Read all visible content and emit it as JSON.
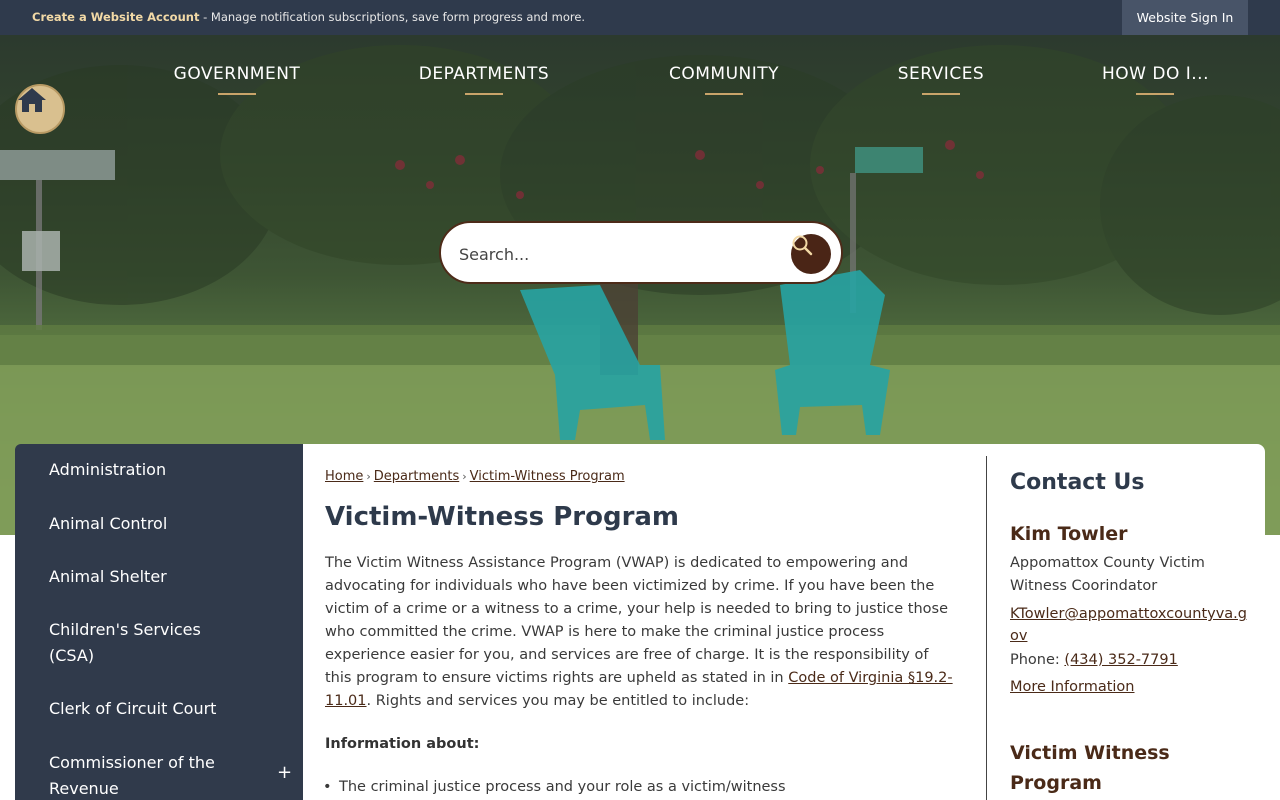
{
  "topbar": {
    "create_account_link": "Create a Website Account",
    "create_account_rest": " - Manage notification subscriptions, save form progress and more.",
    "sign_in": "Website Sign In"
  },
  "nav": {
    "items": [
      "GOVERNMENT",
      "DEPARTMENTS",
      "COMMUNITY",
      "SERVICES",
      "HOW DO I..."
    ]
  },
  "search": {
    "placeholder": "Search..."
  },
  "sidebar": {
    "items": [
      "Administration",
      "Animal Control",
      "Animal Shelter",
      "Children's Services (CSA)",
      "Clerk of Circuit Court",
      "Commissioner of the Revenue"
    ],
    "expand_symbol": "+"
  },
  "breadcrumb": {
    "items": [
      "Home",
      "Departments",
      "Victim-Witness Program"
    ],
    "separator": "›"
  },
  "main": {
    "title": "Victim-Witness Program",
    "intro": "The Victim Witness Assistance Program (VWAP) is dedicated to empowering and advocating for individuals who have been victimized by crime. If you have been the victim of a crime or a witness to a crime, your help is needed to bring to justice those who committed the crime. VWAP is here to make the criminal justice process experience easier for you, and services are free of charge. It is the responsibility of this program to ensure victims rights are upheld as stated in in ",
    "code_link": "Code of Virginia §19.2-11.01",
    "intro_end": ". Rights and services you may be entitled to include:",
    "info_label": "Information about:",
    "bullets": [
      "The criminal justice process and your role as a victim/witness"
    ]
  },
  "contact": {
    "title": "Contact Us",
    "name": "Kim Towler",
    "role": "Appomattox County Victim Witness Coorindator",
    "email": "KTowler@appomattoxcountyva.gov",
    "phone_label": "Phone: ",
    "phone": "(434) 352-7791",
    "more": "More Information",
    "section_title": "Victim Witness Program"
  },
  "colors": {
    "topbar": "#2f3a4c",
    "sidebar": "#303a4b",
    "accent_brown": "#4a2a18",
    "nav_underline": "#c9a46a",
    "home_button": "#d9c08f"
  }
}
